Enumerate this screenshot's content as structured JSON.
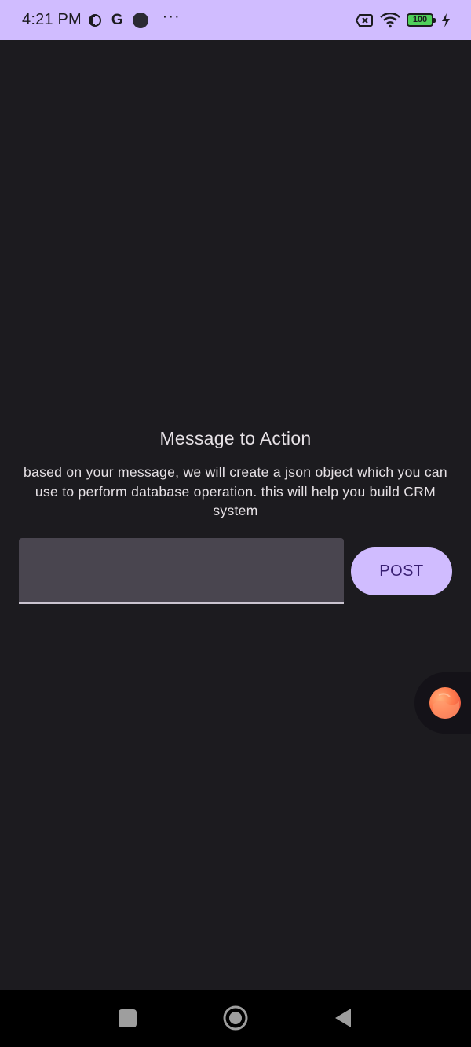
{
  "status_bar": {
    "time": "4:21 PM",
    "g_icon": "G",
    "dots": "···",
    "battery_level": "100",
    "icons": [
      "tempo-icon",
      "google-icon",
      "record-icon",
      "more-dots-icon",
      "sim-off-icon",
      "wifi-icon",
      "battery-icon",
      "charging-bolt-icon"
    ],
    "background_color": "#d0bcff"
  },
  "main": {
    "title": "Message to Action",
    "description": "based on your message, we will create a json object which you can use to perform database operation. this will help you build CRM system",
    "message_input": {
      "value": "",
      "placeholder": ""
    },
    "post_button_label": "POST",
    "background_color": "#1c1b1f",
    "accent_color": "#d0bcff"
  },
  "floating_bubble": {
    "icon": "chat-bubble-icon"
  },
  "nav_bar": {
    "buttons": [
      "recents-icon",
      "home-icon",
      "back-icon"
    ]
  }
}
